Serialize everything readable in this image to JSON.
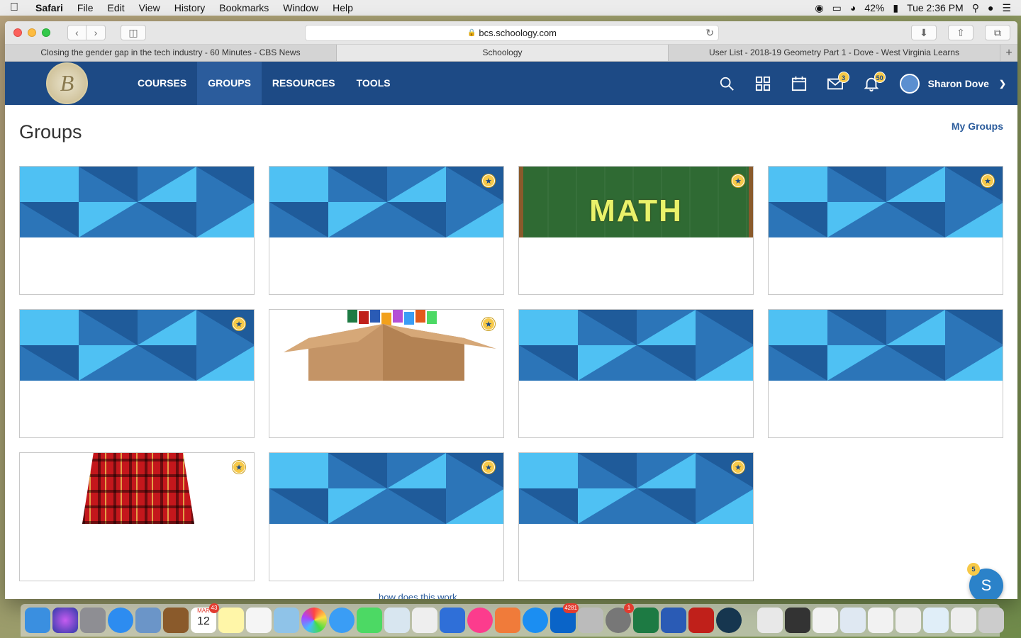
{
  "menubar": {
    "app_name": "Safari",
    "items": [
      "File",
      "Edit",
      "View",
      "History",
      "Bookmarks",
      "Window",
      "Help"
    ],
    "battery": "42%",
    "clock": "Tue 2:36 PM"
  },
  "browser": {
    "url": "bcs.schoology.com",
    "tabs": [
      {
        "title": "Closing the gender gap in the tech industry - 60 Minutes - CBS News"
      },
      {
        "title": "Schoology"
      },
      {
        "title": "User List - 2018-19 Geometry Part 1 - Dove - West Virginia Learns"
      }
    ],
    "active_tab": 1
  },
  "header": {
    "nav": [
      "COURSES",
      "GROUPS",
      "RESOURCES",
      "TOOLS"
    ],
    "active_nav": "GROUPS",
    "messages_badge": "3",
    "notifications_badge": "50",
    "user_name": "Sharon Dove"
  },
  "page": {
    "title": "Groups",
    "my_groups_link": "My Groups",
    "bottom_hint": "how does this work"
  },
  "groups": [
    {
      "banner": "pattern",
      "featured": false
    },
    {
      "banner": "pattern",
      "featured": true
    },
    {
      "banner": "math",
      "featured": true,
      "banner_text": "MATH"
    },
    {
      "banner": "pattern",
      "featured": true
    },
    {
      "banner": "pattern",
      "featured": true
    },
    {
      "banner": "box",
      "featured": true
    },
    {
      "banner": "pattern",
      "featured": false
    },
    {
      "banner": "pattern",
      "featured": false
    },
    {
      "banner": "kilt",
      "featured": true
    },
    {
      "banner": "pattern",
      "featured": true
    },
    {
      "banner": "pattern",
      "featured": true
    }
  ],
  "chat": {
    "label": "S",
    "badge": "5"
  },
  "dock": {
    "calendar_month": "MAR",
    "calendar_day": "12",
    "calendar_badge": "43",
    "outlook_badge": "4281",
    "prefs_badge": "1"
  },
  "colors": {
    "header_bg": "#1d4a85",
    "nav_active_bg": "#2b5c9c",
    "pattern_light": "#4fc1f3",
    "pattern_mid": "#2c75b8",
    "pattern_dark": "#1f5b9a",
    "badge": "#f7c948"
  }
}
